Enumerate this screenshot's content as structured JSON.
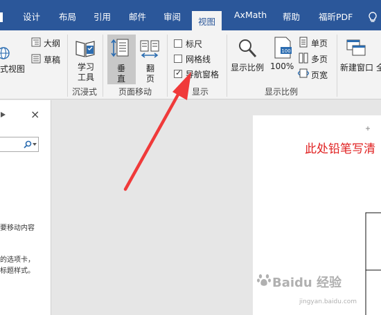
{
  "tabs": [
    {
      "label": "设计"
    },
    {
      "label": "布局"
    },
    {
      "label": "引用"
    },
    {
      "label": "邮件"
    },
    {
      "label": "审阅"
    },
    {
      "label": "视图",
      "active": true
    },
    {
      "label": "AxMath"
    },
    {
      "label": "帮助"
    },
    {
      "label": "福昕PDF"
    }
  ],
  "ribbon": {
    "views": {
      "web_layout": "式视图",
      "outline": "大纲",
      "draft": "草稿"
    },
    "immersive": {
      "learning_tools": [
        "学习",
        "工具"
      ],
      "group_label": "沉浸式"
    },
    "page_movement": {
      "vertical": [
        "垂",
        "直"
      ],
      "side_to_side": [
        "翻",
        "页"
      ],
      "group_label": "页面移动"
    },
    "show": {
      "ruler": {
        "label": "标尺",
        "checked": false
      },
      "gridlines": {
        "label": "网格线",
        "checked": false
      },
      "navigation_pane": {
        "label": "导航窗格",
        "checked": true
      },
      "group_label": "显示"
    },
    "zoom": {
      "zoom_label": "显示比例",
      "percent": "100%",
      "one_page": "单页",
      "multiple_pages": "多页",
      "page_width": "页宽",
      "group_label": "显示比例"
    },
    "window": {
      "new_window": "新建窗口",
      "cut": "全"
    }
  },
  "nav_pane": {
    "close_glyph": "×",
    "text_lines": [
      "要移动内容",
      "的选项卡，",
      "标题样式。"
    ]
  },
  "document": {
    "red_note": "此处铅笔写清"
  },
  "watermark": {
    "main": "Baidu 经验",
    "url": "jingyan.baidu.com"
  },
  "colors": {
    "brand": "#2b579a",
    "annotation": "#e02020"
  }
}
